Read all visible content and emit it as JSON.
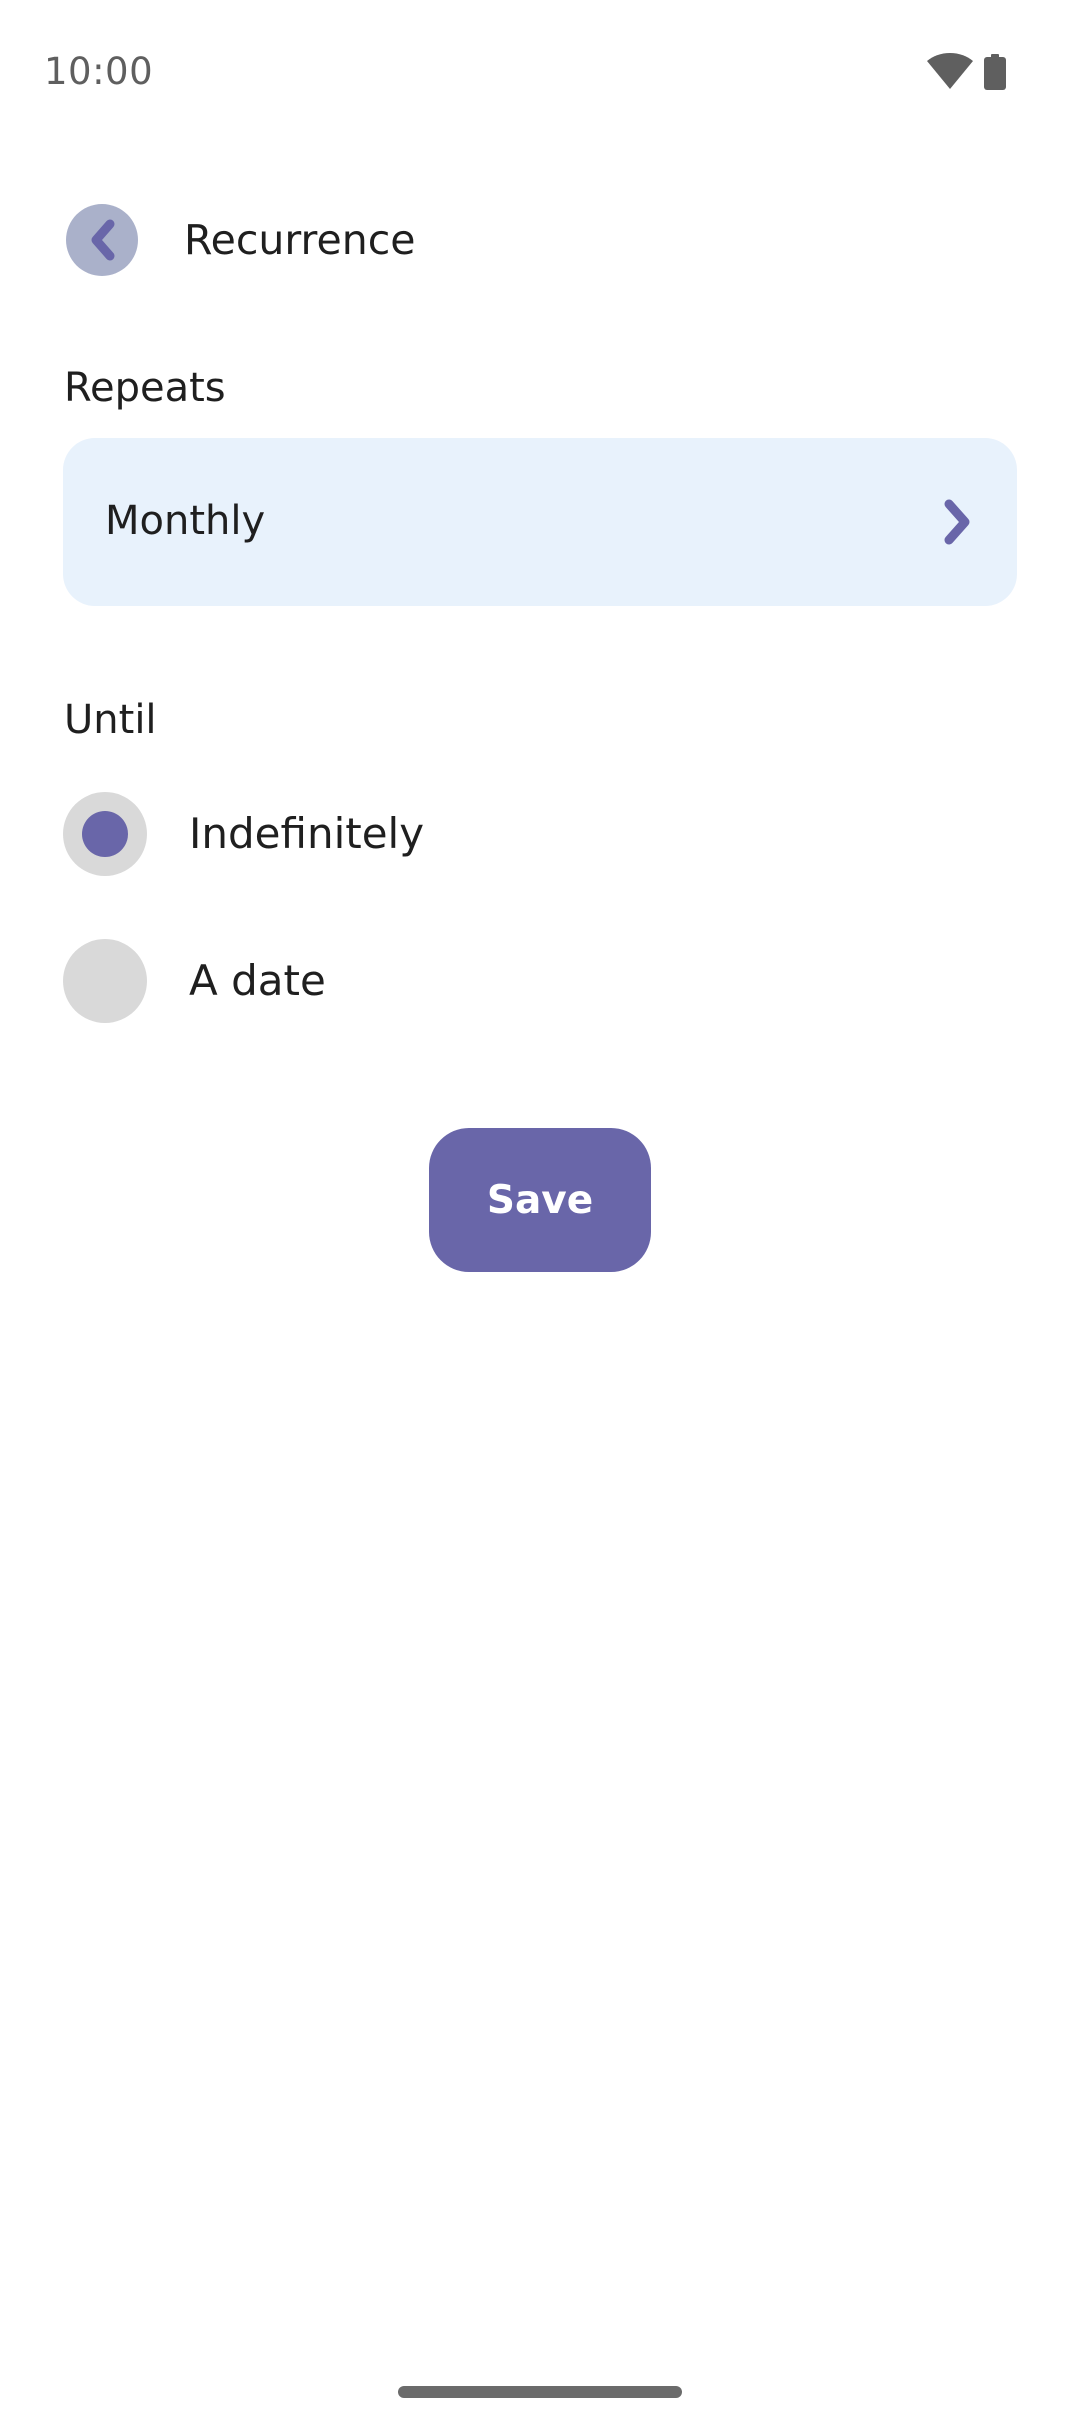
{
  "status_bar": {
    "time": "10:00",
    "icons": [
      "wifi-icon",
      "battery-icon"
    ]
  },
  "header": {
    "back_icon": "chevron-left-icon",
    "title": "Recurrence"
  },
  "repeats": {
    "label": "Repeats",
    "selected_value": "Monthly",
    "icon": "chevron-right-icon"
  },
  "until": {
    "label": "Until",
    "options": [
      {
        "label": "Indefinitely",
        "selected": true
      },
      {
        "label": "A date",
        "selected": false
      }
    ]
  },
  "actions": {
    "save_label": "Save"
  },
  "colors": {
    "accent": "#6966a9",
    "back_button_bg": "#aab1ca",
    "select_bg": "#e8f2fc",
    "radio_bg": "#d9d9d9",
    "text": "#1f1f1f",
    "status_text": "#5f5f5f"
  }
}
